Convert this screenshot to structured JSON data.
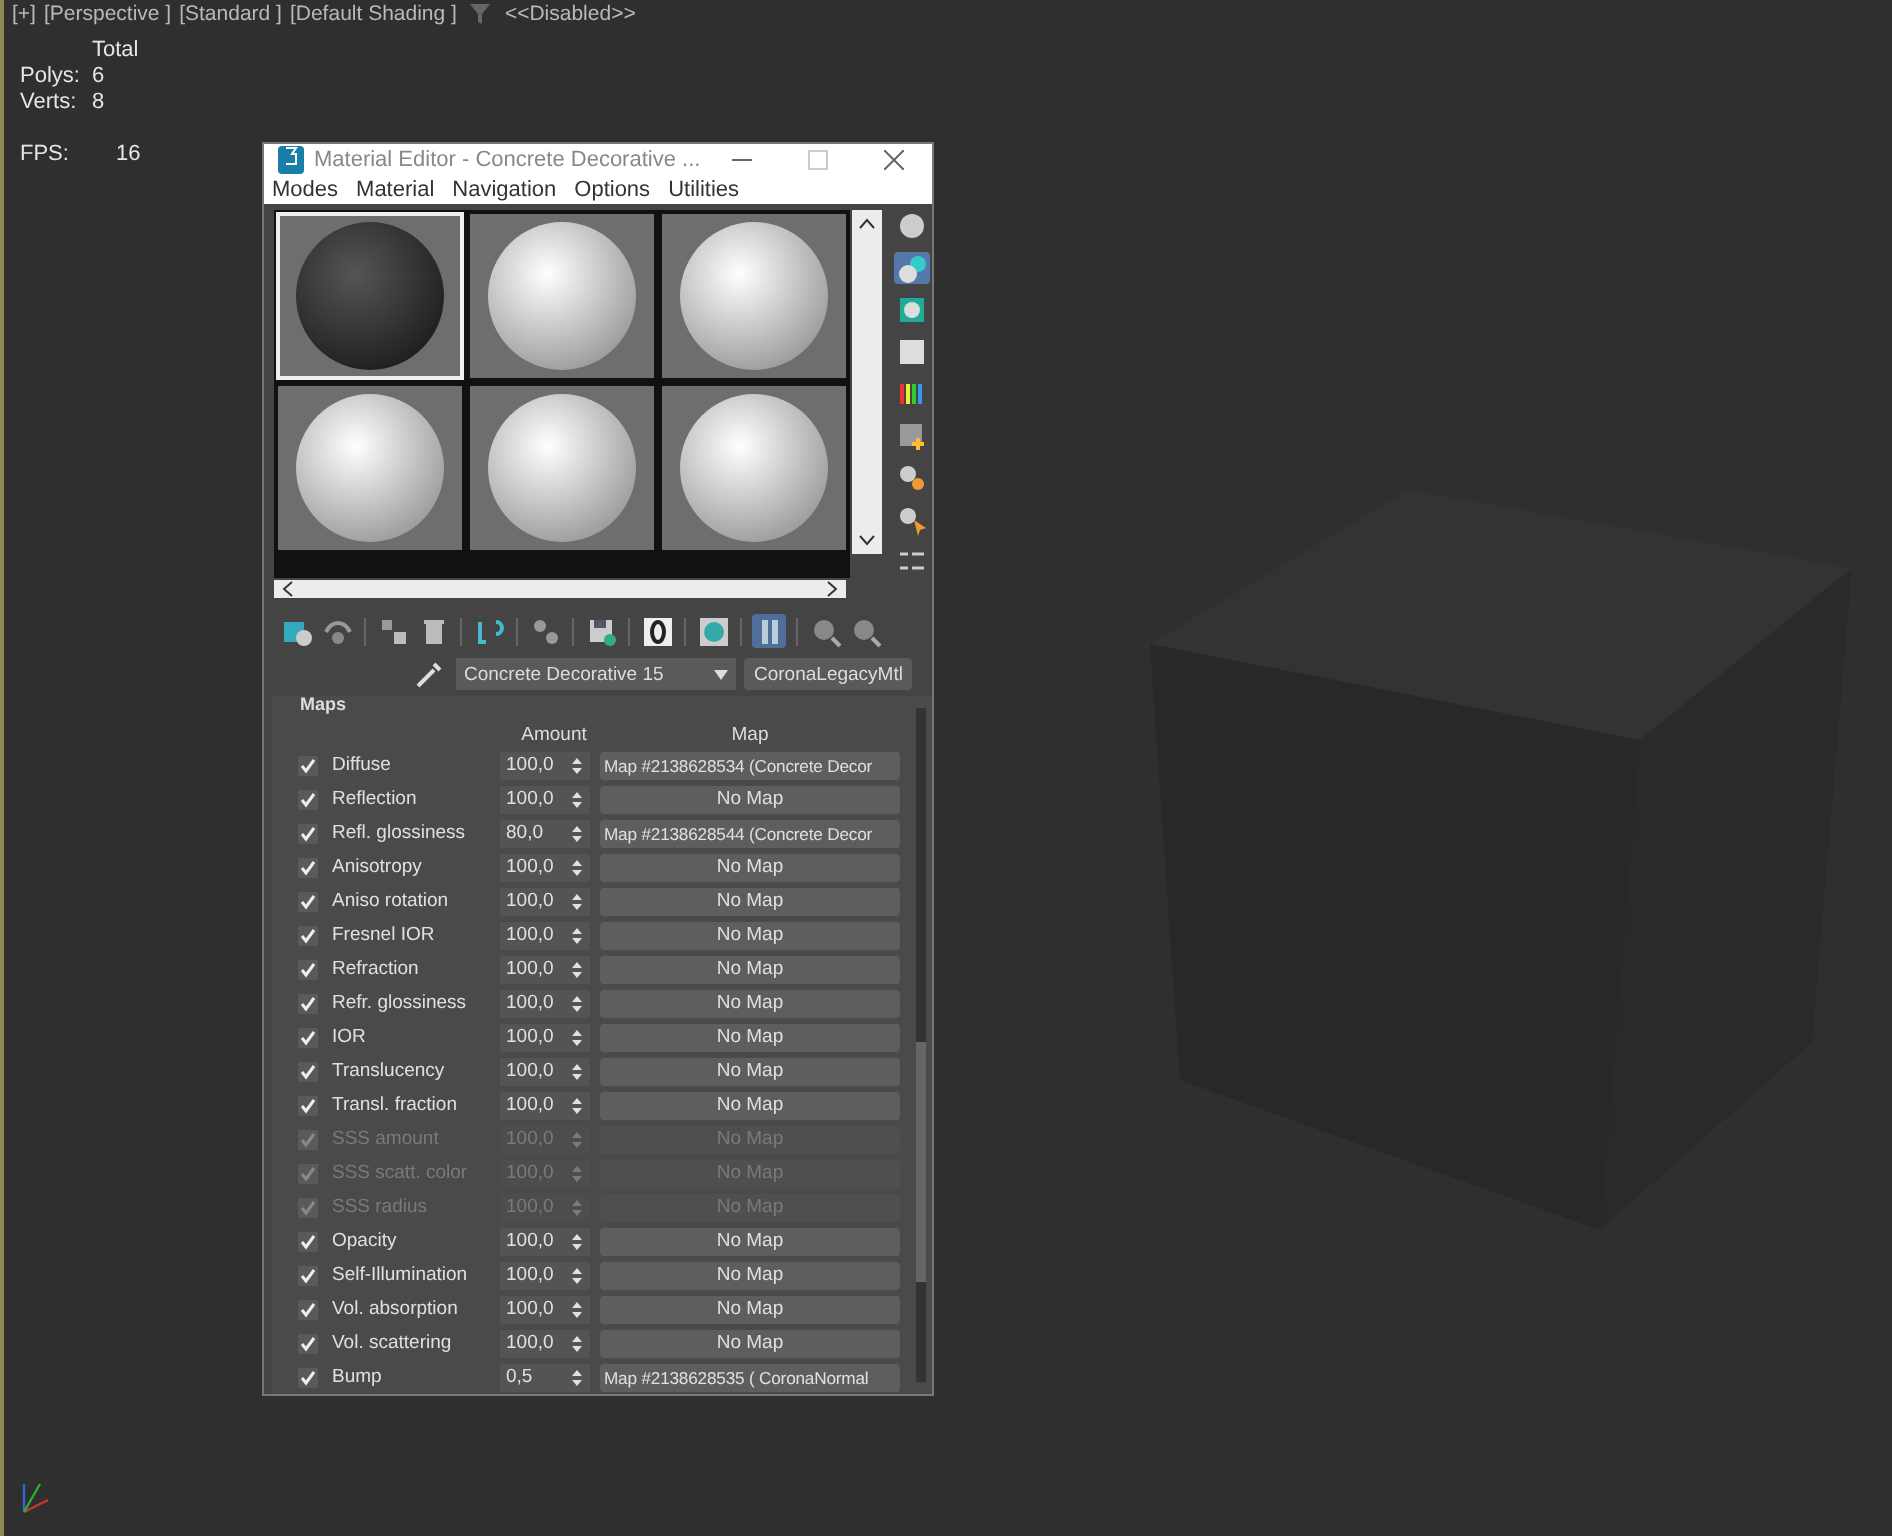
{
  "viewport": {
    "labels": [
      "[+]",
      "[Perspective ]",
      "[Standard ]",
      "[Default Shading ]"
    ],
    "filter": "<<Disabled>>",
    "stats": {
      "header": "Total",
      "rows": [
        {
          "label": "Polys:",
          "value": "6"
        },
        {
          "label": "Verts:",
          "value": "8"
        }
      ],
      "fps_label": "FPS:",
      "fps_value": "16"
    }
  },
  "window": {
    "title": "Material Editor - Concrete Decorative ...",
    "menu": [
      "Modes",
      "Material",
      "Navigation",
      "Options",
      "Utilities"
    ],
    "slots": [
      {
        "kind": "dark",
        "selected": true
      },
      {
        "kind": "light",
        "selected": false
      },
      {
        "kind": "light",
        "selected": false
      },
      {
        "kind": "light",
        "selected": false
      },
      {
        "kind": "light",
        "selected": false
      },
      {
        "kind": "light",
        "selected": false
      }
    ],
    "side_toolbar": [
      {
        "selected": false
      },
      {
        "selected": true
      },
      {
        "selected": false
      },
      {
        "selected": false
      },
      {
        "selected": false
      },
      {
        "selected": false
      },
      {
        "selected": false
      },
      {
        "selected": false
      },
      {
        "selected": false
      }
    ],
    "toolbar": [
      {
        "selected": false
      },
      {
        "selected": false
      },
      {
        "selected": false
      },
      {
        "selected": false
      },
      {
        "selected": false
      },
      {
        "selected": false
      },
      {
        "selected": false
      },
      {
        "selected": false
      },
      {
        "selected": false
      },
      {
        "selected": true
      },
      {
        "selected": false
      },
      {
        "selected": false
      }
    ],
    "material_name": "Concrete Decorative 15",
    "material_type": "CoronaLegacyMtl",
    "maps": {
      "title": "Maps",
      "columns": [
        "Amount",
        "Map"
      ],
      "rows": [
        {
          "label": "Diffuse",
          "checked": true,
          "disabled": false,
          "amount": "100,0",
          "map": "Map #2138628534 (Concrete Decor"
        },
        {
          "label": "Reflection",
          "checked": true,
          "disabled": false,
          "amount": "100,0",
          "map": "No Map"
        },
        {
          "label": "Refl. glossiness",
          "checked": true,
          "disabled": false,
          "amount": "80,0",
          "map": "Map #2138628544 (Concrete Decor"
        },
        {
          "label": "Anisotropy",
          "checked": true,
          "disabled": false,
          "amount": "100,0",
          "map": "No Map"
        },
        {
          "label": "Aniso rotation",
          "checked": true,
          "disabled": false,
          "amount": "100,0",
          "map": "No Map"
        },
        {
          "label": "Fresnel IOR",
          "checked": true,
          "disabled": false,
          "amount": "100,0",
          "map": "No Map"
        },
        {
          "label": "Refraction",
          "checked": true,
          "disabled": false,
          "amount": "100,0",
          "map": "No Map"
        },
        {
          "label": "Refr. glossiness",
          "checked": true,
          "disabled": false,
          "amount": "100,0",
          "map": "No Map"
        },
        {
          "label": "IOR",
          "checked": true,
          "disabled": false,
          "amount": "100,0",
          "map": "No Map"
        },
        {
          "label": "Translucency",
          "checked": true,
          "disabled": false,
          "amount": "100,0",
          "map": "No Map"
        },
        {
          "label": "Transl. fraction",
          "checked": true,
          "disabled": false,
          "amount": "100,0",
          "map": "No Map"
        },
        {
          "label": "SSS amount",
          "checked": true,
          "disabled": true,
          "amount": "100,0",
          "map": "No Map"
        },
        {
          "label": "SSS scatt. color",
          "checked": true,
          "disabled": true,
          "amount": "100,0",
          "map": "No Map"
        },
        {
          "label": "SSS radius",
          "checked": true,
          "disabled": true,
          "amount": "100,0",
          "map": "No Map"
        },
        {
          "label": "Opacity",
          "checked": true,
          "disabled": false,
          "amount": "100,0",
          "map": "No Map"
        },
        {
          "label": "Self-Illumination",
          "checked": true,
          "disabled": false,
          "amount": "100,0",
          "map": "No Map"
        },
        {
          "label": "Vol. absorption",
          "checked": true,
          "disabled": false,
          "amount": "100,0",
          "map": "No Map"
        },
        {
          "label": "Vol. scattering",
          "checked": true,
          "disabled": false,
          "amount": "100,0",
          "map": "No Map"
        },
        {
          "label": "Bump",
          "checked": true,
          "disabled": false,
          "amount": "0,5",
          "map": "Map #2138628535  ( CoronaNormal"
        }
      ]
    }
  }
}
